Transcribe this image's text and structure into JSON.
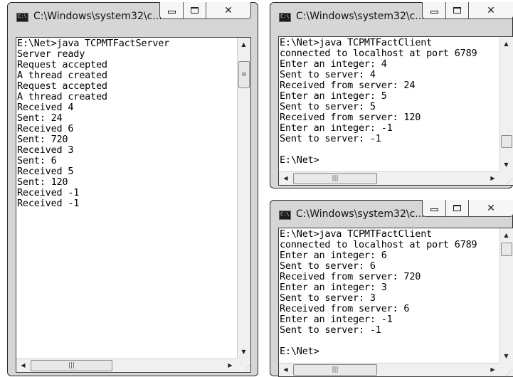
{
  "server_window": {
    "title": "C:\\Windows\\system32\\c...",
    "icon": "cmd-icon",
    "lines": [
      "E:\\Net>java TCPMTFactServer",
      "Server ready",
      "Request accepted",
      "A thread created",
      "Request accepted",
      "A thread created",
      "Received 4",
      "Sent: 24",
      "Received 6",
      "Sent: 720",
      "Received 3",
      "Sent: 6",
      "Received 5",
      "Sent: 120",
      "Received -1",
      "Received -1"
    ]
  },
  "client1_window": {
    "title": "C:\\Windows\\system32\\c...",
    "icon": "cmd-icon",
    "lines": [
      "E:\\Net>java TCPMTFactClient",
      "connected to localhost at port 6789",
      "Enter an integer: 4",
      "Sent to server: 4",
      "Received from server: 24",
      "Enter an integer: 5",
      "Sent to server: 5",
      "Received from server: 120",
      "Enter an integer: -1",
      "Sent to server: -1",
      "",
      "E:\\Net>"
    ]
  },
  "client2_window": {
    "title": "C:\\Windows\\system32\\c...",
    "icon": "cmd-icon",
    "lines": [
      "E:\\Net>java TCPMTFactClient",
      "connected to localhost at port 6789",
      "Enter an integer: 6",
      "Sent to server: 6",
      "Received from server: 720",
      "Enter an integer: 3",
      "Sent to server: 3",
      "Received from server: 6",
      "Enter an integer: -1",
      "Sent to server: -1",
      "",
      "E:\\Net>"
    ]
  },
  "icons": {
    "minimize": "minimize-icon",
    "maximize": "maximize-icon",
    "close": "close-icon",
    "scroll_up": "scroll-up-arrow-icon",
    "scroll_down": "scroll-down-arrow-icon",
    "scroll_left": "scroll-left-arrow-icon",
    "scroll_right": "scroll-right-arrow-icon",
    "thumb_grip": "scroll-thumb-grip-icon",
    "size_grip": "size-grip-icon"
  },
  "colors": {
    "chrome": "#d6d6d6",
    "console_bg": "#ffffff",
    "console_text": "#000000"
  }
}
